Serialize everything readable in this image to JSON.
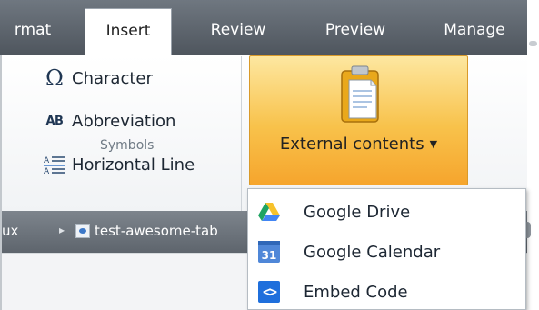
{
  "tabs": [
    {
      "label": "rmat",
      "active": false
    },
    {
      "label": "Insert",
      "active": true
    },
    {
      "label": "Review",
      "active": false
    },
    {
      "label": "Preview",
      "active": false
    },
    {
      "label": "Manage",
      "active": false
    }
  ],
  "ribbon": {
    "symbols_group": {
      "items": [
        {
          "label": "Character",
          "icon": "omega-icon"
        },
        {
          "label": "Abbreviation",
          "icon": "ab-icon"
        },
        {
          "label": "Horizontal Line",
          "icon": "horizontal-line-icon"
        }
      ],
      "group_label": "Symbols"
    },
    "external_contents": {
      "label": "External contents",
      "icon": "clipboard-document-icon"
    }
  },
  "breadcrumb": {
    "items": [
      "ux",
      "test-awesome-tab"
    ]
  },
  "dropdown": {
    "items": [
      {
        "label": "Google Drive",
        "icon": "google-drive-icon"
      },
      {
        "label": "Google Calendar",
        "icon": "google-calendar-icon",
        "badge": "31"
      },
      {
        "label": "Embed Code",
        "icon": "embed-code-icon",
        "glyph": "<>"
      }
    ]
  },
  "colors": {
    "tabbar": "#5f666e",
    "accent_button": "#f8c24b",
    "code_icon": "#1f6fdc",
    "calendar_icon": "#4f87d8"
  }
}
